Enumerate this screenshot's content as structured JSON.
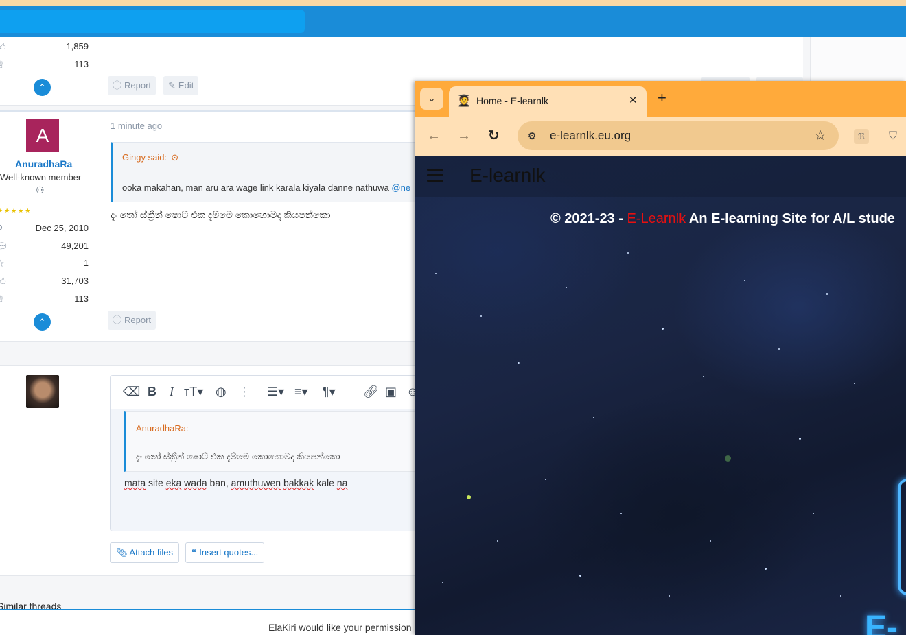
{
  "forum": {
    "post1": {
      "stats": [
        {
          "icon": "like-icon",
          "value": "1,859"
        },
        {
          "icon": "trophy-icon",
          "value": "113"
        }
      ],
      "actions": {
        "report": "Report",
        "edit": "Edit"
      }
    },
    "post2": {
      "avatar_letter": "A",
      "username": "AnuradhaRa",
      "user_title": "Well-known member",
      "time": "1 minute ago",
      "quote": {
        "author": "Gingy said:",
        "text": "ooka makahan, man aru ara wage link karala kiyala danne nathuwa",
        "mention": "@ne"
      },
      "message": "දැං තෝ ස්ක්‍රීන් ෂොට් එක දැම්මෙ කොහොමද කියපන්කො",
      "stats": [
        {
          "icon": "user-icon",
          "value": "Dec 25, 2010"
        },
        {
          "icon": "messages-icon",
          "value": "49,201"
        },
        {
          "icon": "star-icon",
          "value": "1"
        },
        {
          "icon": "like-icon",
          "value": "31,703"
        },
        {
          "icon": "trophy-icon",
          "value": "113"
        }
      ],
      "actions": {
        "report": "Report"
      }
    },
    "reply": {
      "quote_author": "AnuradhaRa:",
      "quote_text": "දැං තෝ ස්ක්‍රීන් ෂොට් එක දැම්මෙ කොහොමද කියපන්කො",
      "draft_words": [
        "mata",
        " site ",
        "eka",
        " ",
        "wada",
        " ban, ",
        "amuthuwen",
        " ",
        "bakkak",
        " kale ",
        "na"
      ],
      "attach_label": "Attach files",
      "insert_quotes_label": "Insert quotes..."
    },
    "similar_threads": "Similar threads",
    "permission_text": "ElaKiri would like your permission"
  },
  "browser": {
    "tab_title": "Home - E-learnlk",
    "url": "e-learnlk.eu.org",
    "colors": {
      "frame": "#ffaa3b",
      "toolbar": "#ffe0b6",
      "omnibox": "#f1c98f"
    }
  },
  "site": {
    "title": "E-learnlk",
    "copyright_prefix": "© 2021-23 - ",
    "brand": "E-Learnlk",
    "copyright_suffix": " An E-learning Site for A/L stude",
    "neon_text": "E-",
    "brand_color": "#e81010"
  }
}
